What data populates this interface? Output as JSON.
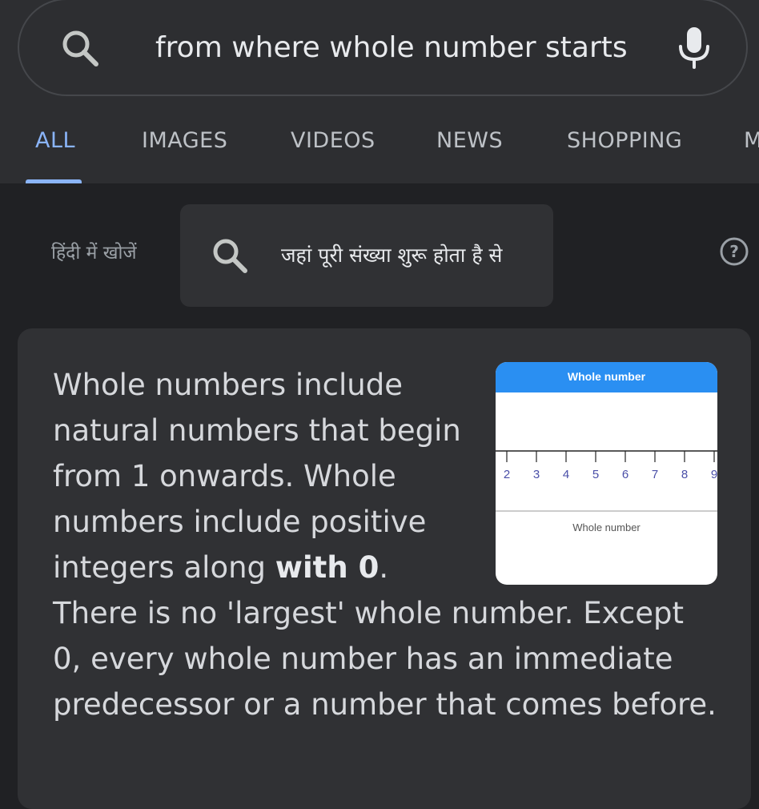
{
  "search": {
    "query": "from where whole number starts",
    "search_icon": "search-icon",
    "mic_icon": "mic-icon"
  },
  "tabs": [
    {
      "label": "ALL",
      "active": true
    },
    {
      "label": "IMAGES",
      "active": false
    },
    {
      "label": "VIDEOS",
      "active": false
    },
    {
      "label": "NEWS",
      "active": false
    },
    {
      "label": "SHOPPING",
      "active": false
    },
    {
      "label": "M",
      "active": false
    }
  ],
  "hindi": {
    "label": "हिंदी में खोजें",
    "chip_text": "जहां पूरी संख्या शुरू होता है से",
    "help_icon": "help-circle-icon"
  },
  "snippet": {
    "text_before": "Whole numbers include natural numbers that begin from 1 onwards. Whole numbers include positive integers along ",
    "bold": "with 0",
    "text_after": ". There is no 'largest' whole number. Except 0, every whole number has an immediate predecessor or a number that comes before."
  },
  "figure": {
    "title": "Whole number",
    "caption": "Whole number",
    "ticks": [
      "2",
      "3",
      "4",
      "5",
      "6",
      "7",
      "8",
      "9"
    ]
  },
  "colors": {
    "accent": "#8ab4f8",
    "figure_header": "#2a8ff2",
    "background": "#202124",
    "surface": "#303134"
  }
}
